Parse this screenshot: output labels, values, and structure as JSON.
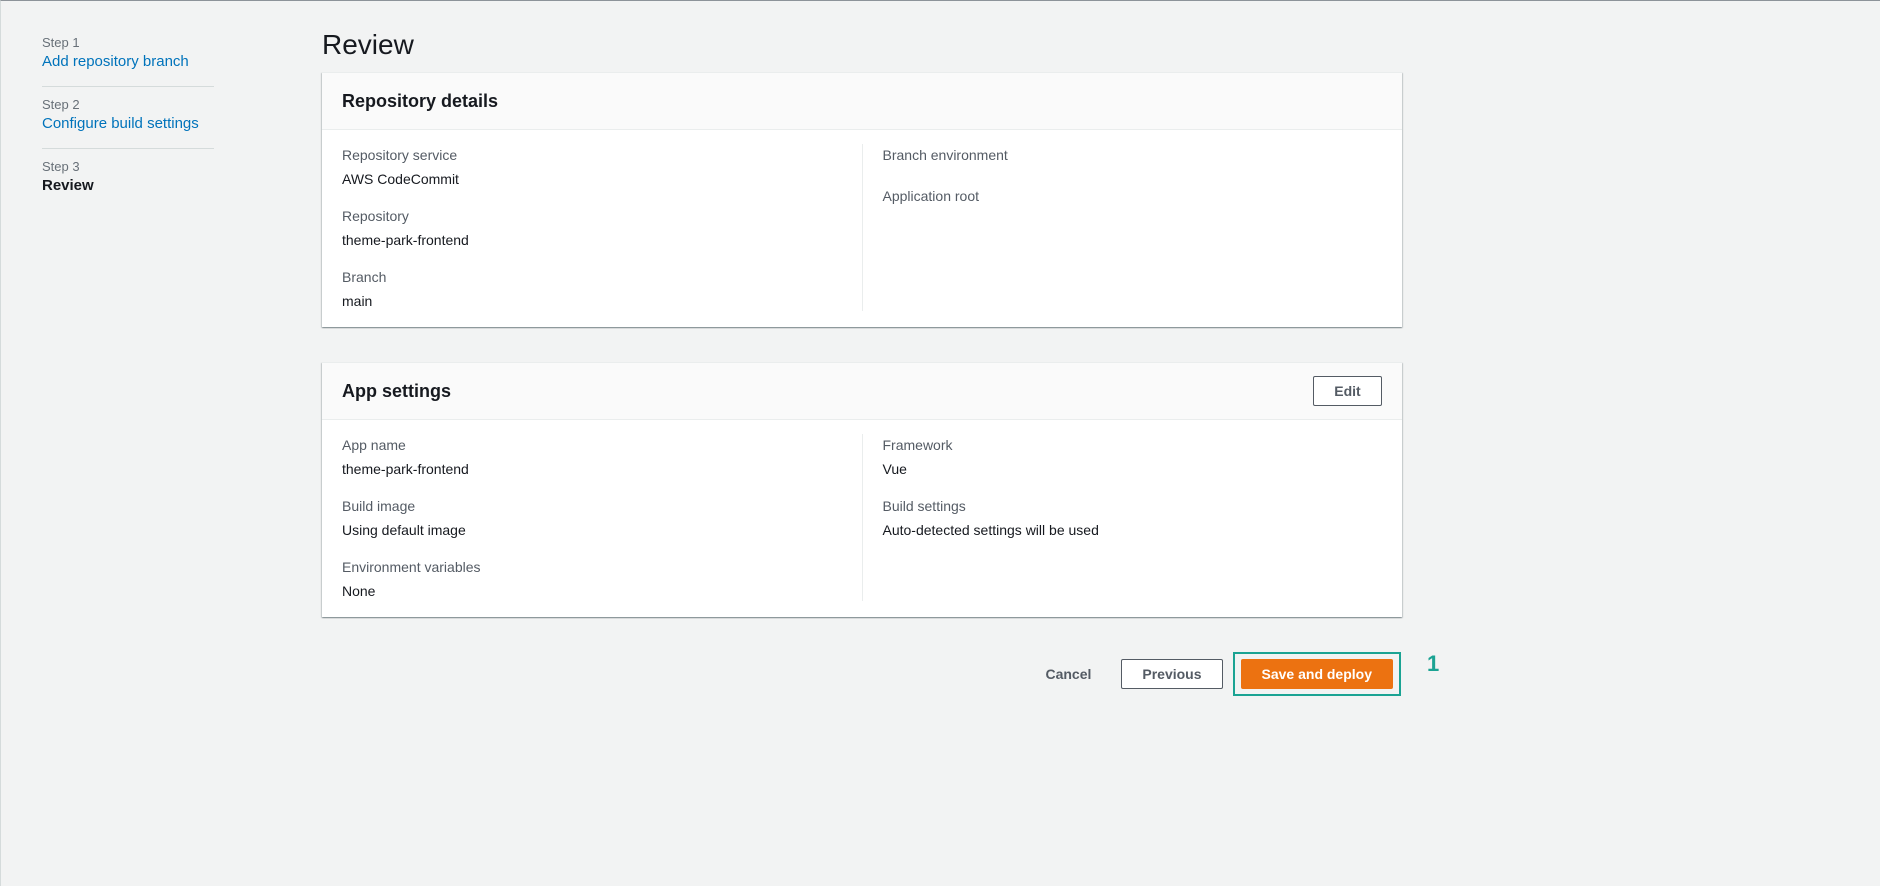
{
  "steps": [
    {
      "number": "Step 1",
      "title": "Add repository branch"
    },
    {
      "number": "Step 2",
      "title": "Configure build settings"
    },
    {
      "number": "Step 3",
      "title": "Review"
    }
  ],
  "page_title": "Review",
  "repository_details": {
    "title": "Repository details",
    "left": [
      {
        "label": "Repository service",
        "value": "AWS CodeCommit"
      },
      {
        "label": "Repository",
        "value": "theme-park-frontend"
      },
      {
        "label": "Branch",
        "value": "main"
      }
    ],
    "right": [
      {
        "label": "Branch environment",
        "value": ""
      },
      {
        "label": "Application root",
        "value": ""
      }
    ]
  },
  "app_settings": {
    "title": "App settings",
    "edit_label": "Edit",
    "left": [
      {
        "label": "App name",
        "value": "theme-park-frontend"
      },
      {
        "label": "Build image",
        "value": "Using default image"
      },
      {
        "label": "Environment variables",
        "value": "None"
      }
    ],
    "right": [
      {
        "label": "Framework",
        "value": "Vue"
      },
      {
        "label": "Build settings",
        "value": "Auto-detected settings will be used"
      }
    ]
  },
  "actions": {
    "cancel_label": "Cancel",
    "previous_label": "Previous",
    "primary_label": "Save and deploy"
  },
  "callout_number": "1",
  "colors": {
    "primary": "#ec7211",
    "link": "#0073bb",
    "highlight": "#1ba393"
  }
}
